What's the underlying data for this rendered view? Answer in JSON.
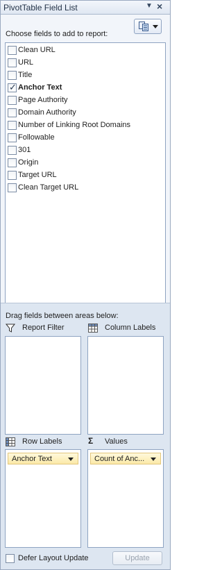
{
  "title_bar": {
    "title": "PivotTable Field List",
    "dropdown_icon": "caret-down-icon",
    "close_icon": "close-icon"
  },
  "top": {
    "choose_label": "Choose fields to add to report:",
    "layout_button_icon": "field-list-layout-icon"
  },
  "fields": [
    {
      "label": "Clean URL",
      "checked": false
    },
    {
      "label": "URL",
      "checked": false
    },
    {
      "label": "Title",
      "checked": false
    },
    {
      "label": "Anchor Text",
      "checked": true
    },
    {
      "label": "Page Authority",
      "checked": false
    },
    {
      "label": "Domain Authority",
      "checked": false
    },
    {
      "label": "Number of Linking Root Domains",
      "checked": false
    },
    {
      "label": "Followable",
      "checked": false
    },
    {
      "label": "301",
      "checked": false
    },
    {
      "label": "Origin",
      "checked": false
    },
    {
      "label": "Target URL",
      "checked": false
    },
    {
      "label": "Clean Target URL",
      "checked": false
    }
  ],
  "areas": {
    "drag_label": "Drag fields between areas below:",
    "report_filter": {
      "label": "Report Filter",
      "icon": "filter-icon"
    },
    "column_labels": {
      "label": "Column Labels",
      "icon": "column-grid-icon"
    },
    "row_labels": {
      "label": "Row Labels",
      "icon": "row-grid-icon",
      "chip": "Anchor Text"
    },
    "values": {
      "label": "Values",
      "icon": "sigma-icon",
      "chip": "Count of Anc..."
    }
  },
  "footer": {
    "defer_label": "Defer Layout Update",
    "defer_checked": false,
    "update_label": "Update"
  }
}
